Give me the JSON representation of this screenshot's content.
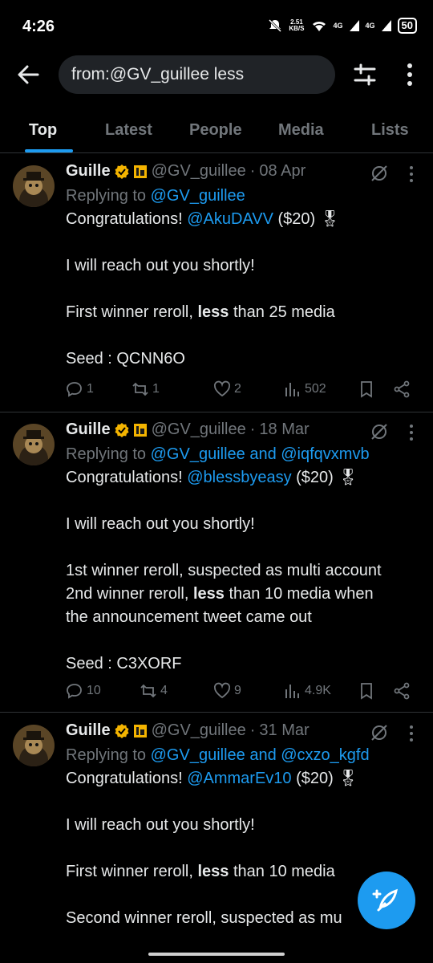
{
  "status": {
    "time": "4:26",
    "speed": "2.51",
    "speed_unit": "KB/S",
    "net1": "4G",
    "net2": "4G",
    "battery": "50"
  },
  "search": {
    "query": "from:@GV_guillee less"
  },
  "tabs": [
    "Top",
    "Latest",
    "People",
    "Media",
    "Lists"
  ],
  "tweets": [
    {
      "name": "Guille",
      "handle": "@GV_guillee",
      "dot": "·",
      "date": "08 Apr",
      "reply_prefix": "Replying to ",
      "reply_to": "@GV_guillee",
      "congrats": "Congratulations! ",
      "mention": "@AkuDAVV",
      "prize": " ($20) 🎖",
      "line2": "I will reach out you shortly!",
      "line3_a": "First winner reroll, ",
      "line3_b": "less",
      "line3_c": " than 25 media",
      "seed": "Seed : QCNN6O",
      "replies": "1",
      "reposts": "1",
      "likes": "2",
      "views": "502"
    },
    {
      "name": "Guille",
      "handle": "@GV_guillee",
      "dot": "·",
      "date": "18 Mar",
      "reply_prefix": "Replying to ",
      "reply_to": "@GV_guillee and @iqfqvxmvb",
      "congrats": "Congratulations! ",
      "mention": "@blessbyeasy",
      "prize": " ($20) 🎖",
      "line2": "I will reach out you shortly!",
      "line3": "1st winner reroll, suspected as multi account",
      "line4_a": "2nd winner reroll, ",
      "line4_b": "less",
      "line4_c": " than 10 media when",
      "line5": "the announcement tweet came out",
      "seed": "Seed : C3XORF",
      "replies": "10",
      "reposts": "4",
      "likes": "9",
      "views": "4.9K"
    },
    {
      "name": "Guille",
      "handle": "@GV_guillee",
      "dot": "·",
      "date": "31 Mar",
      "reply_prefix": "Replying to ",
      "reply_to": "@GV_guillee and @cxzo_kgfd",
      "congrats": "Congratulations! ",
      "mention": "@AmmarEv10",
      "prize": " ($20) 🎖",
      "line2": "I will reach out you shortly!",
      "line3_a": "First winner reroll, ",
      "line3_b": "less",
      "line3_c": " than 10 media",
      "line4": "Second winner reroll, suspected as mu"
    }
  ],
  "colors": {
    "accent": "#1d9bf0",
    "muted": "#71767b",
    "verified": "#f4b400",
    "background": "#000000"
  },
  "icons": [
    "back-arrow-icon",
    "filter-sliders-icon",
    "more-vertical-icon",
    "verified-gold-icon",
    "affiliate-badge-icon",
    "grok-icon",
    "reply-icon",
    "repost-icon",
    "like-icon",
    "views-icon",
    "bookmark-icon",
    "share-icon",
    "compose-icon"
  ]
}
